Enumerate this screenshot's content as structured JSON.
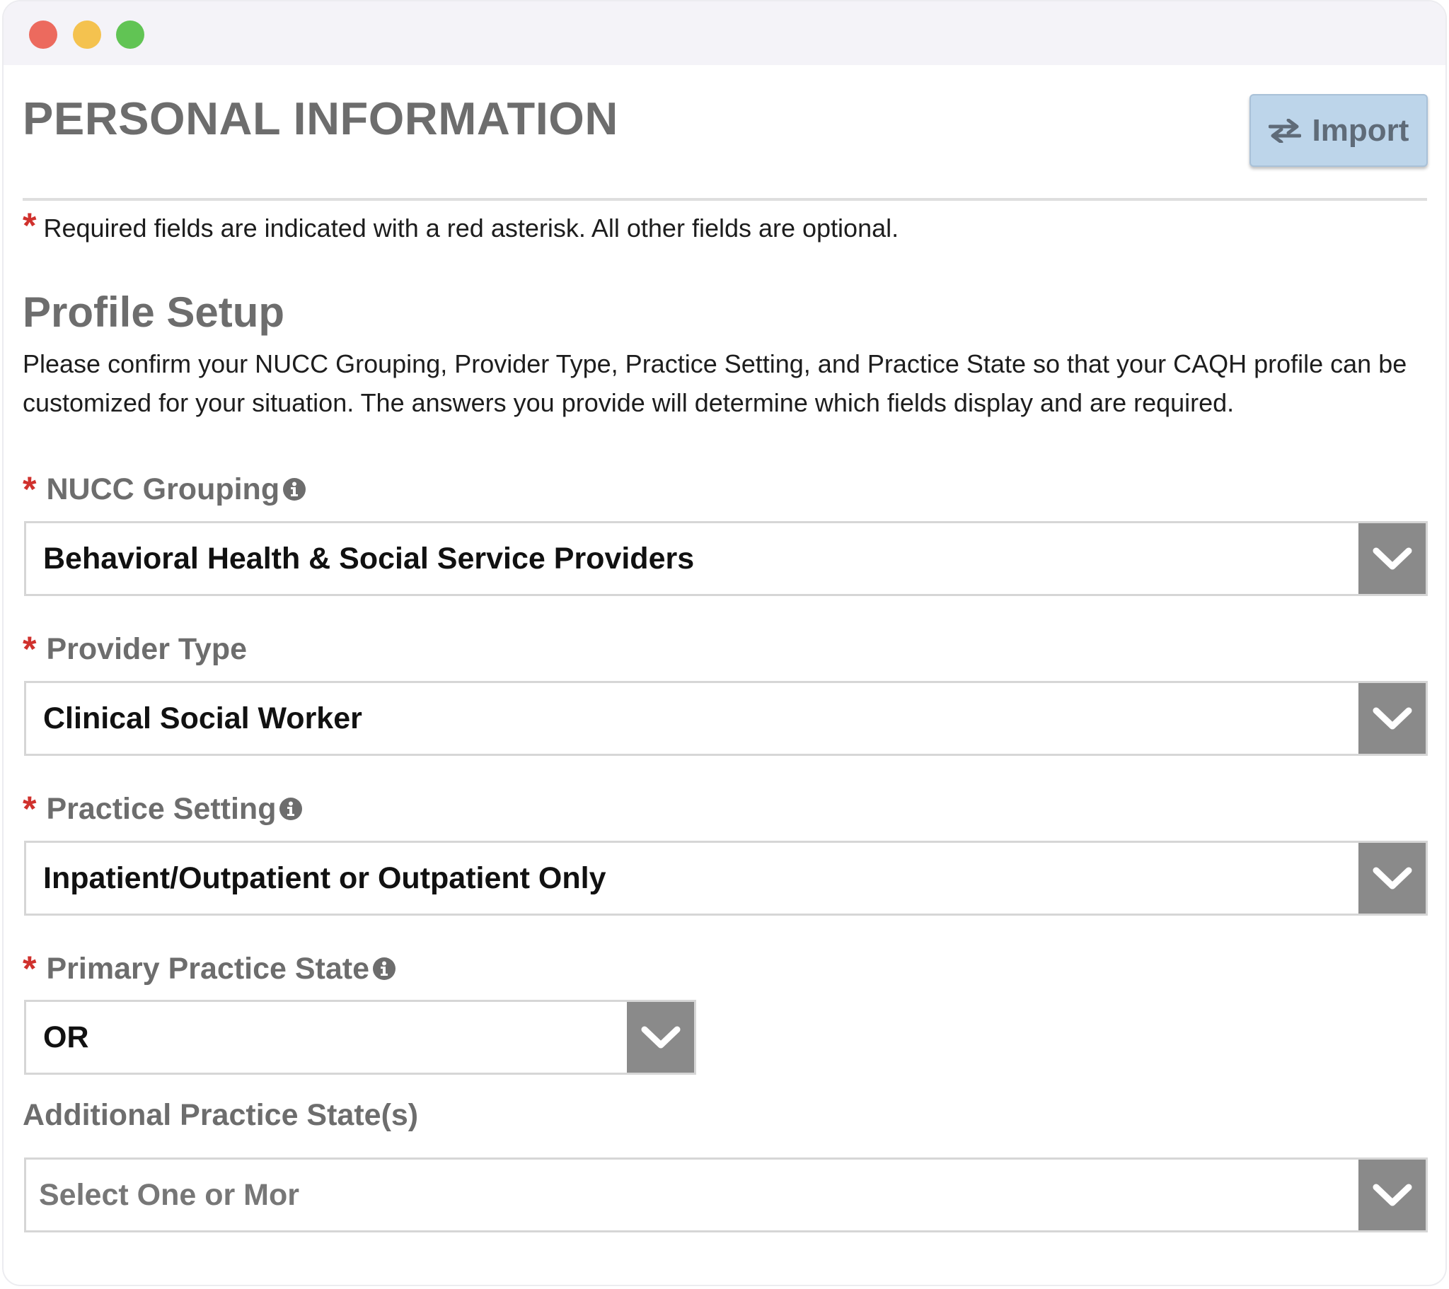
{
  "header": {
    "title": "PERSONAL INFORMATION",
    "import_label": "Import"
  },
  "required_note": {
    "asterisk": "*",
    "text": "Required fields are indicated with a red asterisk. All other fields are optional."
  },
  "profile_setup": {
    "title": "Profile Setup",
    "description": "Please confirm your NUCC Grouping, Provider Type, Practice Setting, and Practice State so that your CAQH profile can be customized for your situation. The answers you provide will determine which fields display and are required."
  },
  "fields": {
    "nucc_grouping": {
      "label": "NUCC Grouping",
      "required": true,
      "has_info": true,
      "value": "Behavioral Health & Social Service Providers"
    },
    "provider_type": {
      "label": "Provider Type",
      "required": true,
      "has_info": false,
      "value": "Clinical Social Worker"
    },
    "practice_setting": {
      "label": "Practice Setting",
      "required": true,
      "has_info": true,
      "value": "Inpatient/Outpatient or Outpatient Only"
    },
    "primary_practice_state": {
      "label": "Primary Practice State",
      "required": true,
      "has_info": true,
      "value": "OR"
    },
    "additional_practice_states": {
      "label": "Additional Practice State(s)",
      "required": false,
      "has_info": false,
      "placeholder": "Select One or Mor"
    }
  },
  "icons": {
    "import": "swap-arrows-icon",
    "info": "info-circle-icon",
    "dropdown": "chevron-down-icon"
  },
  "colors": {
    "required_asterisk": "#d0312d",
    "import_button_bg": "#bdd5ea",
    "dropdown_arrow_bg": "#8a8a8a",
    "heading_text": "#6d6d6d"
  }
}
